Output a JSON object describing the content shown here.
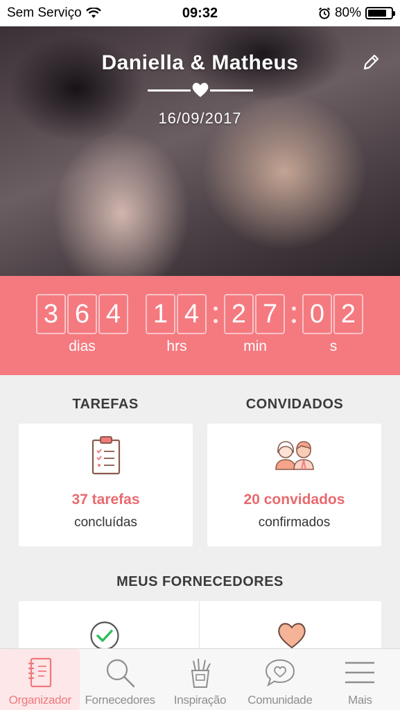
{
  "status_bar": {
    "carrier": "Sem Serviço",
    "time": "09:32",
    "battery_percent": "80%",
    "battery_level": 0.8
  },
  "hero": {
    "couple_names": "Daniella & Matheus",
    "wedding_date": "16/09/2017"
  },
  "countdown": {
    "days_digits": [
      "3",
      "6",
      "4"
    ],
    "hours_digits": [
      "1",
      "4"
    ],
    "minutes_digits": [
      "2",
      "7"
    ],
    "seconds_digits": [
      "0",
      "2"
    ],
    "days_label": "dias",
    "hours_label": "hrs",
    "minutes_label": "min",
    "seconds_label": "s"
  },
  "tasks": {
    "title": "TAREFAS",
    "count": "37 tarefas",
    "subtitle": "concluídas"
  },
  "guests": {
    "title": "CONVIDADOS",
    "count": "20 convidados",
    "subtitle": "confirmados"
  },
  "vendors": {
    "title": "MEUS FORNECEDORES"
  },
  "tabbar": {
    "items": [
      {
        "label": "Organizador",
        "icon": "notebook-icon",
        "active": true
      },
      {
        "label": "Fornecedores",
        "icon": "search-icon",
        "active": false
      },
      {
        "label": "Inspiração",
        "icon": "brush-cup-icon",
        "active": false
      },
      {
        "label": "Comunidade",
        "icon": "chat-heart-icon",
        "active": false
      },
      {
        "label": "Mais",
        "icon": "menu-icon",
        "active": false
      }
    ]
  },
  "colors": {
    "accent": "#f47a80",
    "accent_text": "#e86a6f",
    "check_green": "#2ebd5c",
    "heart_peach": "#f5b398"
  }
}
